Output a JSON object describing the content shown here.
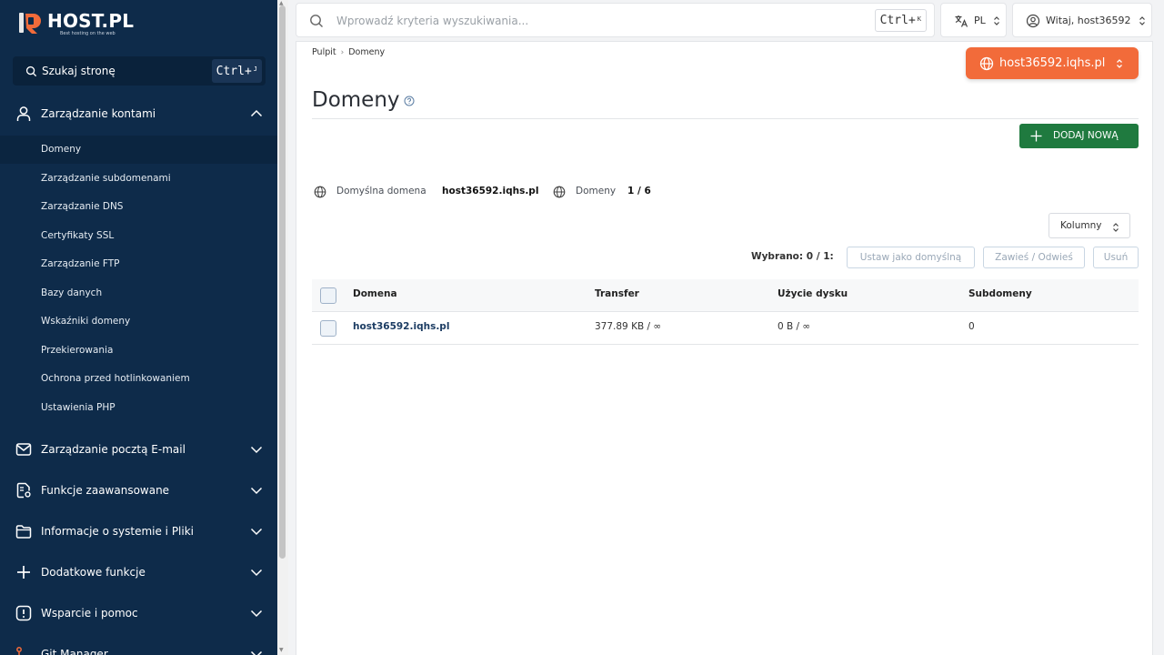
{
  "brand": {
    "name": "HOST.PL",
    "tagline": "Best hosting on the web"
  },
  "sidebar": {
    "search_label": "Szukaj stronę",
    "search_shortcut": "Ctrl+",
    "search_shortcut_key": "J",
    "groups": [
      {
        "label": "Zarządzanie kontami",
        "icon": "user-icon",
        "expanded": true,
        "items": [
          {
            "label": "Domeny",
            "active": true
          },
          {
            "label": "Zarządzanie subdomenami"
          },
          {
            "label": "Zarządzanie DNS"
          },
          {
            "label": "Certyfikaty SSL"
          },
          {
            "label": "Zarządzanie FTP"
          },
          {
            "label": "Bazy danych"
          },
          {
            "label": "Wskaźniki domeny"
          },
          {
            "label": "Przekierowania"
          },
          {
            "label": "Ochrona przed hotlinkowaniem"
          },
          {
            "label": "Ustawienia PHP"
          }
        ]
      },
      {
        "label": "Zarządzanie pocztą E-mail",
        "icon": "mail-icon"
      },
      {
        "label": "Funkcje zaawansowane",
        "icon": "advanced-settings-icon"
      },
      {
        "label": "Informacje o systemie i Pliki",
        "icon": "folder-icon"
      },
      {
        "label": "Dodatkowe funkcje",
        "icon": "plus-icon"
      },
      {
        "label": "Wsparcie i pomoc",
        "icon": "alert-icon"
      },
      {
        "label": "Git Manager",
        "icon": "git-icon"
      }
    ]
  },
  "topbar": {
    "search_placeholder": "Wprowadź kryteria wyszukiwania...",
    "search_shortcut": "Ctrl+",
    "search_shortcut_key": "K",
    "language": "PL",
    "user_greeting": "Witaj, host36592"
  },
  "breadcrumb": [
    "Pulpit",
    "Domeny"
  ],
  "account_selector": "host36592.iqhs.pl",
  "page": {
    "title": "Domeny",
    "add_button": "DODAJ NOWĄ",
    "default_domain_label": "Domyślna domena",
    "default_domain_value": "host36592.iqhs.pl",
    "domains_label": "Domeny",
    "domains_count": "1 / 6",
    "columns_button": "Kolumny",
    "selected_label": "Wybrano: 0 / 1:",
    "actions": [
      "Ustaw jako domyślną",
      "Zawieś / Odwieś",
      "Usuń"
    ]
  },
  "table": {
    "headers": [
      "Domena",
      "Transfer",
      "Użycie dysku",
      "Subdomeny"
    ],
    "rows": [
      {
        "domain": "host36592.iqhs.pl",
        "transfer": "377.89 KB / ∞",
        "disk": "0 B / ∞",
        "subdomains": "0"
      }
    ]
  },
  "colors": {
    "sidebar_bg": "#0e2b4a",
    "accent_orange": "#f26b3a",
    "add_green": "#1f7a3f",
    "link_blue": "#1d3d63"
  }
}
